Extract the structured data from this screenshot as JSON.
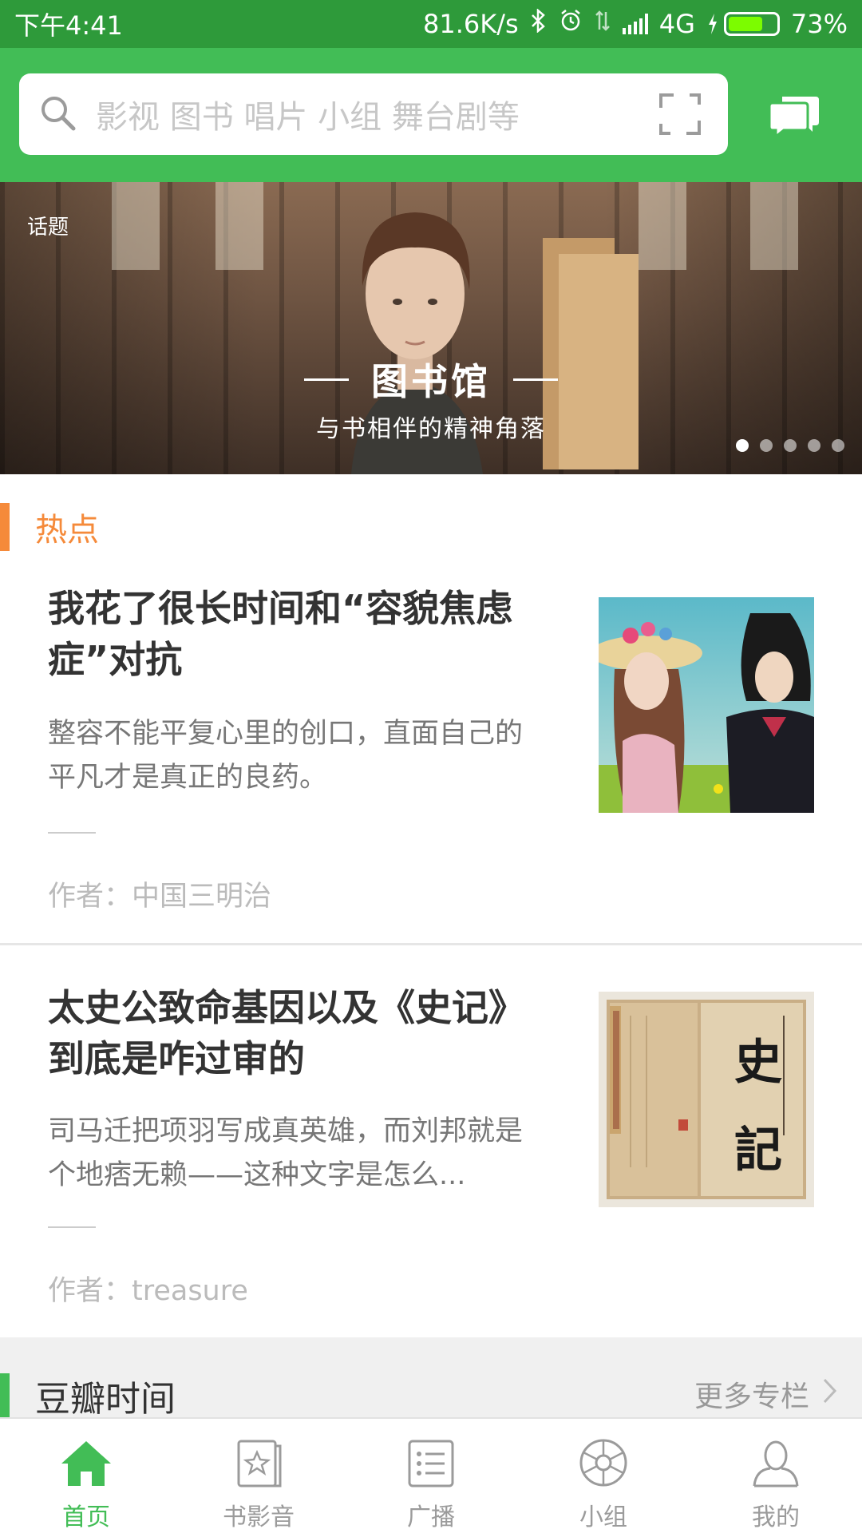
{
  "status_bar": {
    "time": "下午4:41",
    "speed": "81.6K/s",
    "network": "4G",
    "battery": "73%",
    "battery_level": 0.73
  },
  "search": {
    "placeholder": "影视 图书 唱片 小组 舞台剧等"
  },
  "banner": {
    "tag": "话题",
    "title": "图书馆",
    "subtitle": "与书相伴的精神角落",
    "page_count": 5,
    "active_page": 1
  },
  "hot_section": {
    "label": "热点"
  },
  "articles": [
    {
      "title": "我花了很长时间和“容貌焦虑症”对抗",
      "desc": "整容不能平复心里的创口，直面自己的平凡才是真正的良药。",
      "author": "作者：中国三明治"
    },
    {
      "title": "太史公致命基因以及《史记》到底是咋过审的",
      "desc": "司马迁把项羽写成真英雄，而刘邦就是个地痞无赖——这种文字是怎么...",
      "author": "作者：treasure",
      "thumb_text_1": "史",
      "thumb_text_2": "記"
    }
  ],
  "section2": {
    "label": "豆瓣时间",
    "more": "更多专栏"
  },
  "nav": [
    {
      "label": "首页",
      "icon": "home-icon",
      "active": true
    },
    {
      "label": "书影音",
      "icon": "book-movie-icon",
      "active": false
    },
    {
      "label": "广播",
      "icon": "broadcast-icon",
      "active": false
    },
    {
      "label": "小组",
      "icon": "group-icon",
      "active": false
    },
    {
      "label": "我的",
      "icon": "profile-icon",
      "active": false
    }
  ],
  "colors": {
    "status_bar": "#2e9a3a",
    "header": "#42bd56",
    "hot_accent": "#f58a3a",
    "nav_active": "#42bd56"
  }
}
